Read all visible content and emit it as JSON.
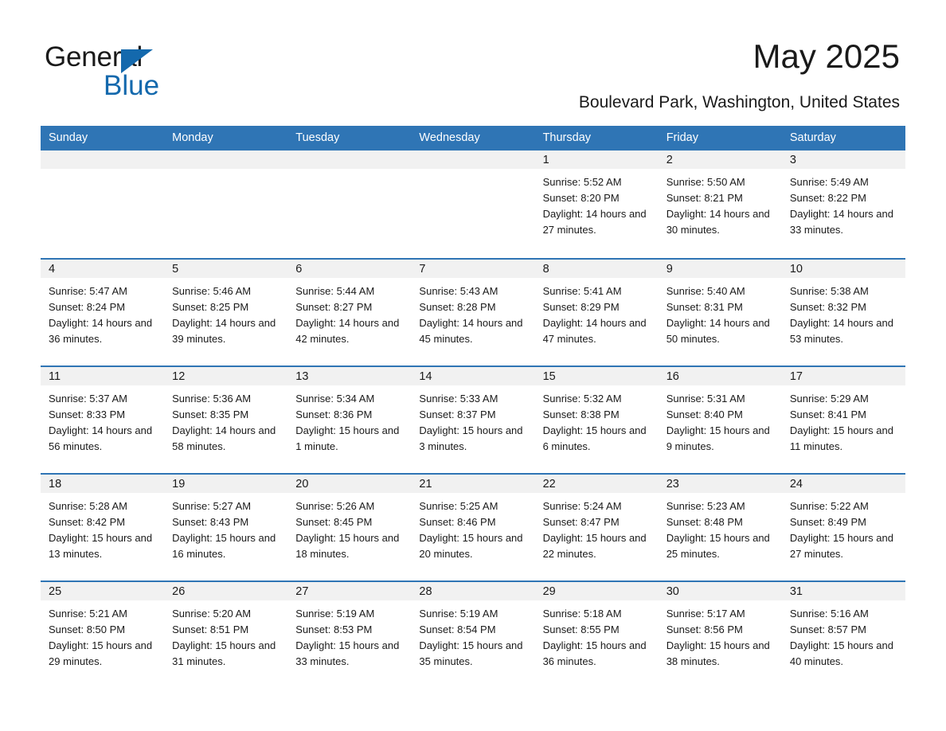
{
  "brand": {
    "name_part1": "General",
    "name_part2": "Blue",
    "triangle_color": "#1469ad",
    "blue_color": "#1469ad"
  },
  "header": {
    "month_title": "May 2025",
    "location": "Boulevard Park, Washington, United States",
    "header_bg": "#2f75b5",
    "daynum_bg": "#f1f1f1",
    "separator_color": "#2f75b5"
  },
  "weekdays": [
    "Sunday",
    "Monday",
    "Tuesday",
    "Wednesday",
    "Thursday",
    "Friday",
    "Saturday"
  ],
  "labels": {
    "sunrise_prefix": "Sunrise:",
    "sunset_prefix": "Sunset:",
    "daylight_prefix": "Daylight:"
  },
  "weeks": [
    [
      {
        "day": "",
        "empty": true
      },
      {
        "day": "",
        "empty": true
      },
      {
        "day": "",
        "empty": true
      },
      {
        "day": "",
        "empty": true
      },
      {
        "day": "1",
        "sunrise": "Sunrise: 5:52 AM",
        "sunset": "Sunset: 8:20 PM",
        "daylight": "Daylight: 14 hours and 27 minutes."
      },
      {
        "day": "2",
        "sunrise": "Sunrise: 5:50 AM",
        "sunset": "Sunset: 8:21 PM",
        "daylight": "Daylight: 14 hours and 30 minutes."
      },
      {
        "day": "3",
        "sunrise": "Sunrise: 5:49 AM",
        "sunset": "Sunset: 8:22 PM",
        "daylight": "Daylight: 14 hours and 33 minutes."
      }
    ],
    [
      {
        "day": "4",
        "sunrise": "Sunrise: 5:47 AM",
        "sunset": "Sunset: 8:24 PM",
        "daylight": "Daylight: 14 hours and 36 minutes."
      },
      {
        "day": "5",
        "sunrise": "Sunrise: 5:46 AM",
        "sunset": "Sunset: 8:25 PM",
        "daylight": "Daylight: 14 hours and 39 minutes."
      },
      {
        "day": "6",
        "sunrise": "Sunrise: 5:44 AM",
        "sunset": "Sunset: 8:27 PM",
        "daylight": "Daylight: 14 hours and 42 minutes."
      },
      {
        "day": "7",
        "sunrise": "Sunrise: 5:43 AM",
        "sunset": "Sunset: 8:28 PM",
        "daylight": "Daylight: 14 hours and 45 minutes."
      },
      {
        "day": "8",
        "sunrise": "Sunrise: 5:41 AM",
        "sunset": "Sunset: 8:29 PM",
        "daylight": "Daylight: 14 hours and 47 minutes."
      },
      {
        "day": "9",
        "sunrise": "Sunrise: 5:40 AM",
        "sunset": "Sunset: 8:31 PM",
        "daylight": "Daylight: 14 hours and 50 minutes."
      },
      {
        "day": "10",
        "sunrise": "Sunrise: 5:38 AM",
        "sunset": "Sunset: 8:32 PM",
        "daylight": "Daylight: 14 hours and 53 minutes."
      }
    ],
    [
      {
        "day": "11",
        "sunrise": "Sunrise: 5:37 AM",
        "sunset": "Sunset: 8:33 PM",
        "daylight": "Daylight: 14 hours and 56 minutes."
      },
      {
        "day": "12",
        "sunrise": "Sunrise: 5:36 AM",
        "sunset": "Sunset: 8:35 PM",
        "daylight": "Daylight: 14 hours and 58 minutes."
      },
      {
        "day": "13",
        "sunrise": "Sunrise: 5:34 AM",
        "sunset": "Sunset: 8:36 PM",
        "daylight": "Daylight: 15 hours and 1 minute."
      },
      {
        "day": "14",
        "sunrise": "Sunrise: 5:33 AM",
        "sunset": "Sunset: 8:37 PM",
        "daylight": "Daylight: 15 hours and 3 minutes."
      },
      {
        "day": "15",
        "sunrise": "Sunrise: 5:32 AM",
        "sunset": "Sunset: 8:38 PM",
        "daylight": "Daylight: 15 hours and 6 minutes."
      },
      {
        "day": "16",
        "sunrise": "Sunrise: 5:31 AM",
        "sunset": "Sunset: 8:40 PM",
        "daylight": "Daylight: 15 hours and 9 minutes."
      },
      {
        "day": "17",
        "sunrise": "Sunrise: 5:29 AM",
        "sunset": "Sunset: 8:41 PM",
        "daylight": "Daylight: 15 hours and 11 minutes."
      }
    ],
    [
      {
        "day": "18",
        "sunrise": "Sunrise: 5:28 AM",
        "sunset": "Sunset: 8:42 PM",
        "daylight": "Daylight: 15 hours and 13 minutes."
      },
      {
        "day": "19",
        "sunrise": "Sunrise: 5:27 AM",
        "sunset": "Sunset: 8:43 PM",
        "daylight": "Daylight: 15 hours and 16 minutes."
      },
      {
        "day": "20",
        "sunrise": "Sunrise: 5:26 AM",
        "sunset": "Sunset: 8:45 PM",
        "daylight": "Daylight: 15 hours and 18 minutes."
      },
      {
        "day": "21",
        "sunrise": "Sunrise: 5:25 AM",
        "sunset": "Sunset: 8:46 PM",
        "daylight": "Daylight: 15 hours and 20 minutes."
      },
      {
        "day": "22",
        "sunrise": "Sunrise: 5:24 AM",
        "sunset": "Sunset: 8:47 PM",
        "daylight": "Daylight: 15 hours and 22 minutes."
      },
      {
        "day": "23",
        "sunrise": "Sunrise: 5:23 AM",
        "sunset": "Sunset: 8:48 PM",
        "daylight": "Daylight: 15 hours and 25 minutes."
      },
      {
        "day": "24",
        "sunrise": "Sunrise: 5:22 AM",
        "sunset": "Sunset: 8:49 PM",
        "daylight": "Daylight: 15 hours and 27 minutes."
      }
    ],
    [
      {
        "day": "25",
        "sunrise": "Sunrise: 5:21 AM",
        "sunset": "Sunset: 8:50 PM",
        "daylight": "Daylight: 15 hours and 29 minutes."
      },
      {
        "day": "26",
        "sunrise": "Sunrise: 5:20 AM",
        "sunset": "Sunset: 8:51 PM",
        "daylight": "Daylight: 15 hours and 31 minutes."
      },
      {
        "day": "27",
        "sunrise": "Sunrise: 5:19 AM",
        "sunset": "Sunset: 8:53 PM",
        "daylight": "Daylight: 15 hours and 33 minutes."
      },
      {
        "day": "28",
        "sunrise": "Sunrise: 5:19 AM",
        "sunset": "Sunset: 8:54 PM",
        "daylight": "Daylight: 15 hours and 35 minutes."
      },
      {
        "day": "29",
        "sunrise": "Sunrise: 5:18 AM",
        "sunset": "Sunset: 8:55 PM",
        "daylight": "Daylight: 15 hours and 36 minutes."
      },
      {
        "day": "30",
        "sunrise": "Sunrise: 5:17 AM",
        "sunset": "Sunset: 8:56 PM",
        "daylight": "Daylight: 15 hours and 38 minutes."
      },
      {
        "day": "31",
        "sunrise": "Sunrise: 5:16 AM",
        "sunset": "Sunset: 8:57 PM",
        "daylight": "Daylight: 15 hours and 40 minutes."
      }
    ]
  ]
}
